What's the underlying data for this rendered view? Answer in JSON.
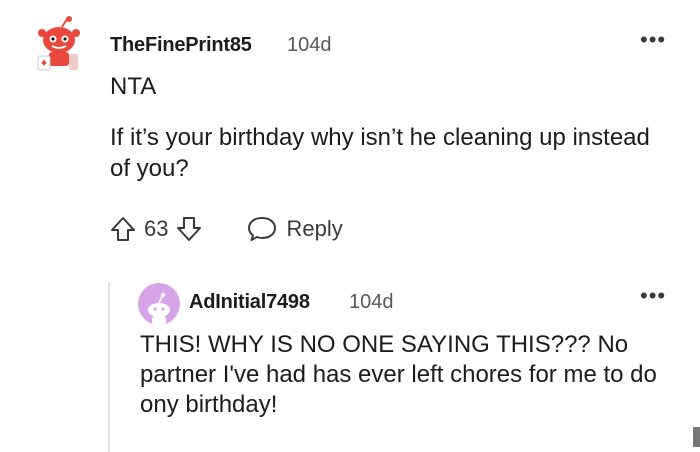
{
  "comment": {
    "username": "TheFinePrint85",
    "age": "104d",
    "more": "•••",
    "verdict": "NTA",
    "text": "If it’s your birthday why isn’t he cleaning up instead of you?",
    "score": "63",
    "reply_label": "Reply"
  },
  "reply": {
    "username": "AdInitial7498",
    "age": "104d",
    "more": "•••",
    "text": "THIS! WHY IS NO ONE SAYING THIS??? No partner I've had has ever left chores for me to do ony birthday!"
  },
  "icons": [
    "snoo-avatar",
    "upvote-icon",
    "downvote-icon",
    "comment-bubble-icon",
    "snoo-avatar-purple",
    "more-options-icon"
  ],
  "colors": {
    "text": "#1c1c1c",
    "meta": "#575757",
    "icon": "#3a3a3a",
    "reply_avatar_bg": "#d6a4e6",
    "snoo_red": "#e8483d"
  }
}
